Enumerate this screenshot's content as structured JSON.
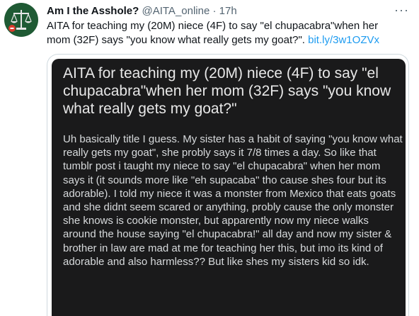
{
  "author": {
    "display_name": "Am I the Asshole?",
    "handle": "@AITA_online",
    "separator": "·",
    "time": "17h",
    "avatar_icon": "scales-of-justice-icon"
  },
  "more_icon": "···",
  "tweet": {
    "text": "AITA for teaching my (20M) niece (4F) to say \"el chupacabra\"when her mom (32F) says \"you know what really gets my goat?\". ",
    "link": "bit.ly/3w1OZVx"
  },
  "embedded_post": {
    "title": "AITA for teaching my (20M) niece (4F) to say \"el chupacabra\"when her mom (32F) says \"you know what really gets my goat?\"",
    "body": "Uh basically title I guess. My sister has a habit of saying \"you know what really gets my goat\", she probly says it 7/8 times a day. So like that tumblr post i taught my niece to say \"el chupacabra\" when her mom says it (it sounds more like \"eh supacaba\" tho cause shes four but its adorable). I told my niece it was a monster from Mexico that eats goats and she didnt seem scared or anything, probly cause the only monster she knows is cookie monster, but apparently now my niece walks around the house saying \"el chupacabra!\" all day and now my sister & brother in law are mad at me for teaching her this, but imo its kind of adorable and also harmless?? But like shes my sisters kid so idk."
  },
  "colors": {
    "link": "#1d9bf0",
    "card_background": "#1a1a1b",
    "avatar_background": "#1f5a34"
  }
}
